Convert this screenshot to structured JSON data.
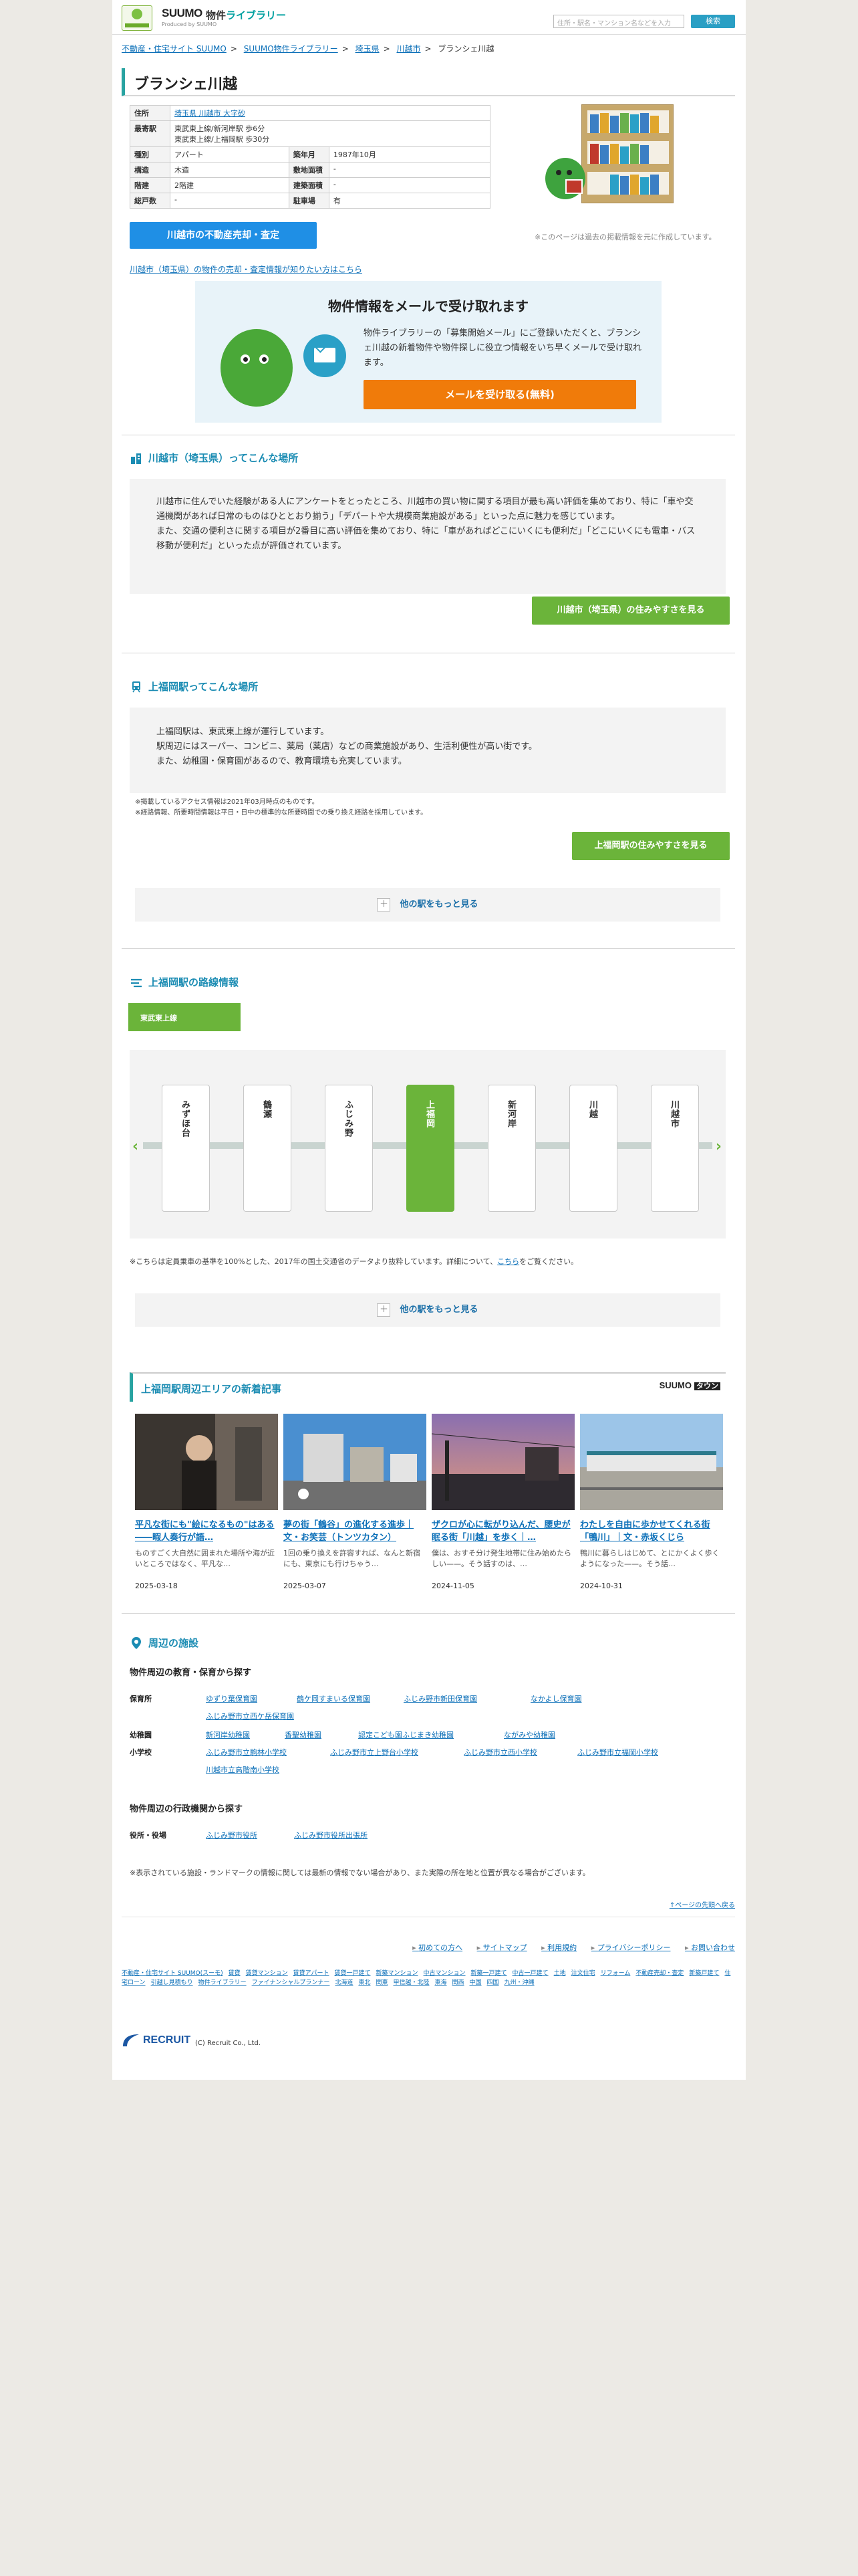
{
  "header": {
    "suumo_logo": "SUUMO",
    "lib_logo_a": "物件",
    "lib_logo_b": "ライブラリー",
    "logo_sub": "Produced by SUUMO",
    "search_placeholder": "住所・駅名・マンション名などを入力",
    "search_button": "検索"
  },
  "breadcrumb": [
    "不動産・住宅サイト SUUMO",
    "SUUMO物件ライブラリー",
    "埼玉県",
    "川越市",
    "ブランシェ川越"
  ],
  "title": "ブランシェ川越",
  "props": {
    "rows": [
      {
        "k": "住所",
        "v": "埼玉県 川越市 大字砂",
        "k2": "",
        "v2": ""
      },
      {
        "k": "最寄駅",
        "v": "東武東上線/新河岸駅 歩6分\n東武東上線/上福岡駅 歩30分",
        "k2": "",
        "v2": ""
      },
      {
        "k": "種別",
        "v": "アパート",
        "k2": "築年月",
        "v2": "1987年10月"
      },
      {
        "k": "構造",
        "v": "木造",
        "k2": "敷地面積",
        "v2": "-"
      },
      {
        "k": "階建",
        "v": "2階建",
        "k2": "建築面積",
        "v2": "-"
      },
      {
        "k": "総戸数",
        "v": "-",
        "k2": "駐車場",
        "v2": "有"
      }
    ],
    "address_link": "埼玉県 川越市 大字砂"
  },
  "past_note": "※このページは過去の掲載情報を元に作成しています。",
  "sale_button": "川越市の不動産売却・査定",
  "sell_link": "川越市（埼玉県）の物件の売却・査定情報が知りたい方はこちら",
  "mail": {
    "title": "物件情報をメールで受け取れます",
    "text": "物件ライブラリーの「募集開始メール」にご登録いただくと、ブランシェ川越の新着物件や物件探しに役立つ情報をいち早くメールで受け取れます。",
    "button": "メールを受け取る(無料)"
  },
  "city": {
    "heading": "川越市（埼玉県）ってこんな場所",
    "text": "川越市に住んでいた経験がある人にアンケートをとったところ、川越市の買い物に関する項目が最も高い評価を集めており、特に「車や交通機関があれば日常のものはひととおり揃う」「デパートや大規模商業施設がある」といった点に魅力を感じています。\nまた、交通の便利さに関する項目が2番目に高い評価を集めており、特に「車があればどこにいくにも便利だ」「どこにいくにも電車・バス移動が便利だ」といった点が評価されています。",
    "button": "川越市（埼玉県）の住みやすさを見る"
  },
  "station": {
    "heading": "上福岡駅ってこんな場所",
    "text": "上福岡駅は、東武東上線が運行しています。\n駅周辺にはスーパー、コンビニ、薬局（薬店）などの商業施設があり、生活利便性が高い街です。\nまた、幼稚園・保育園があるので、教育環境も充実しています。",
    "notes": "※掲載しているアクセス情報は2021年03月時点のものです。\n※経路情報、所要時間情報は平日・日中の標準的な所要時間での乗り換え経路を採用しています。",
    "button": "上福岡駅の住みやすさを見る",
    "more": "他の駅をもっと見る"
  },
  "route": {
    "heading": "上福岡駅の路線情報",
    "line_tab": "東武東上線",
    "stations": [
      "みずほ台",
      "鶴瀬",
      "ふじみ野",
      "上福岡",
      "新河岸",
      "川越",
      "川越市"
    ],
    "current_index": 3,
    "note_a": "※こちらは定員乗車の基準を100%とした、2017年の国土交通省のデータより抜粋しています。詳細について、",
    "note_link": "こちら",
    "note_b": "をご覧ください。",
    "more": "他の駅をもっと見る"
  },
  "news": {
    "heading": "上福岡駅周辺エリアの新着記事",
    "brand_a": "SUUMO",
    "brand_b": "タウン",
    "cards": [
      {
        "title": "平凡な街にも\"絵になるもの\"はある――暇人奏行が語…",
        "desc": "ものすごく大自然に囲まれた場所や海が近いところではなく、平凡な…",
        "date": "2025-03-18"
      },
      {
        "title": "夢の街「鶴谷」の進化する進歩｜文・お笑芸（トンツカタン）",
        "desc": "1回の乗り換えを許容すれば、なんと新宿にも、東京にも行けちゃう…",
        "date": "2025-03-07"
      },
      {
        "title": "ザクロが心に転がり込んだ、腰史が眠る街「川越」を歩く｜…",
        "desc": "僕は、おすそ分け発生地帯に住み始めたらしい——。そう話すのは、…",
        "date": "2024-11-05"
      },
      {
        "title": "わたしを自由に歩かせてくれる街「鴨川」｜文・赤坂くじら",
        "desc": "鴨川に暮らしはじめて、とにかくよく歩くようになった——。そう話…",
        "date": "2024-10-31"
      }
    ]
  },
  "facilities": {
    "heading": "周辺の施設",
    "edu_heading": "物件周辺の教育・保育から探す",
    "nursery_k": "保育所",
    "nursery": [
      "ゆずり葉保育園",
      "鶴ケ岡すまいる保育園",
      "ふじみ野市新田保育園",
      "なかよし保育園",
      "ふじみ野市立西ケ岳保育園"
    ],
    "kinder_k": "幼稚園",
    "kinder": [
      "新河岸幼稚園",
      "香聖幼稚園",
      "認定こども園ふじまき幼稚園",
      "ながみや幼稚園"
    ],
    "elem_k": "小学校",
    "elem": [
      "ふじみ野市立駒林小学校",
      "ふじみ野市立上野台小学校",
      "ふじみ野市立西小学校",
      "ふじみ野市立福岡小学校",
      "川越市立高階南小学校"
    ],
    "gov_heading": "物件周辺の行政機関から探す",
    "gov_k": "役所・役場",
    "gov": [
      "ふじみ野市役所",
      "ふじみ野市役所出張所"
    ],
    "note": "※表示されている施設・ランドマークの情報に関しては最新の情報でない場合があり、また実際の所在地と位置が異なる場合がございます。"
  },
  "footer": {
    "top": "↑ページの先頭へ戻る",
    "links": [
      "初めての方へ",
      "サイトマップ",
      "利用規約",
      "プライバシーポリシー",
      "お問い合わせ"
    ],
    "sitemap": [
      "不動産・住宅サイト SUUMO(スーモ)",
      "賃貸",
      "賃貸マンション",
      "賃貸アパート",
      "賃貸一戸建て",
      "新築マンション",
      "中古マンション",
      "新築一戸建て",
      "中古一戸建て",
      "土地",
      "注文住宅",
      "リフォーム",
      "不動産売却・査定",
      "新築戸建て",
      "住宅ローン",
      "引越し見積もり",
      "物件ライブラリー",
      "ファイナンシャルプランナー",
      "北海道",
      "東北",
      "関東",
      "甲信越・北陸",
      "東海",
      "関西",
      "中国",
      "四国",
      "九州・沖縄"
    ],
    "recruit": "RECRUIT",
    "copy": "(C) Recruit Co., Ltd."
  }
}
